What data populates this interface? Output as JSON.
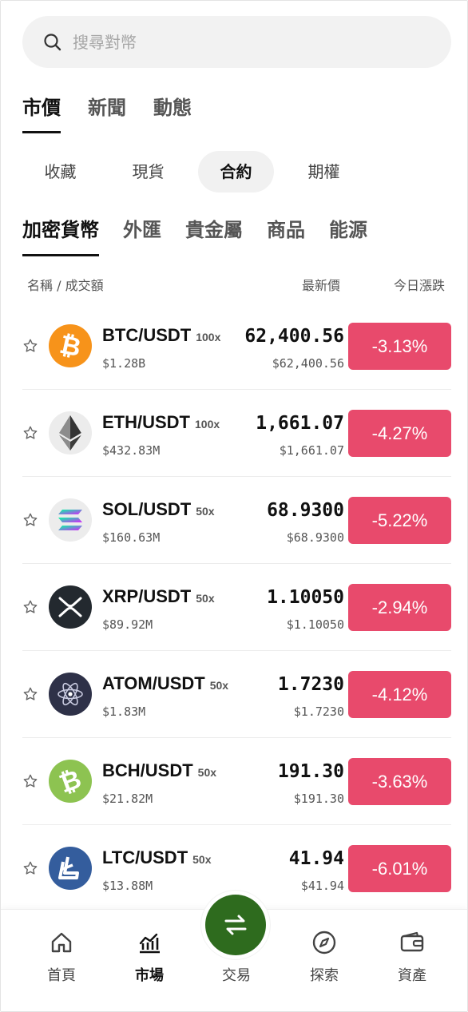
{
  "search": {
    "placeholder": "搜尋對幣"
  },
  "top_tabs": [
    {
      "label": "市價",
      "active": true
    },
    {
      "label": "新聞",
      "active": false
    },
    {
      "label": "動態",
      "active": false
    }
  ],
  "segments": [
    {
      "label": "收藏",
      "active": false
    },
    {
      "label": "現貨",
      "active": false
    },
    {
      "label": "合約",
      "active": true
    },
    {
      "label": "期權",
      "active": false
    }
  ],
  "categories": [
    {
      "label": "加密貨幣",
      "active": true
    },
    {
      "label": "外匯",
      "active": false
    },
    {
      "label": "貴金屬",
      "active": false
    },
    {
      "label": "商品",
      "active": false
    },
    {
      "label": "能源",
      "active": false
    }
  ],
  "columns": {
    "name": "名稱 / 成交額",
    "price": "最新價",
    "change": "今日漲跌"
  },
  "rows": [
    {
      "pair": "BTC/USDT",
      "leverage": "100x",
      "volume": "$1.28B",
      "price": "62,400.56",
      "price_usd": "$62,400.56",
      "change": "-3.13%",
      "icon": "bitcoin-icon",
      "icon_color": "#f7931a"
    },
    {
      "pair": "ETH/USDT",
      "leverage": "100x",
      "volume": "$432.83M",
      "price": "1,661.07",
      "price_usd": "$1,661.07",
      "change": "-4.27%",
      "icon": "ethereum-icon",
      "icon_color": "#ececec"
    },
    {
      "pair": "SOL/USDT",
      "leverage": "50x",
      "volume": "$160.63M",
      "price": "68.9300",
      "price_usd": "$68.9300",
      "change": "-5.22%",
      "icon": "solana-icon",
      "icon_color": "#ececec"
    },
    {
      "pair": "XRP/USDT",
      "leverage": "50x",
      "volume": "$89.92M",
      "price": "1.10050",
      "price_usd": "$1.10050",
      "change": "-2.94%",
      "icon": "xrp-icon",
      "icon_color": "#23292f"
    },
    {
      "pair": "ATOM/USDT",
      "leverage": "50x",
      "volume": "$1.83M",
      "price": "1.7230",
      "price_usd": "$1.7230",
      "change": "-4.12%",
      "icon": "cosmos-atom-icon",
      "icon_color": "#2e3148"
    },
    {
      "pair": "BCH/USDT",
      "leverage": "50x",
      "volume": "$21.82M",
      "price": "191.30",
      "price_usd": "$191.30",
      "change": "-3.63%",
      "icon": "bitcoin-cash-icon",
      "icon_color": "#8dc351"
    },
    {
      "pair": "LTC/USDT",
      "leverage": "50x",
      "volume": "$13.88M",
      "price": "41.94",
      "price_usd": "$41.94",
      "change": "-6.01%",
      "icon": "litecoin-icon",
      "icon_color": "#345d9d"
    }
  ],
  "colors": {
    "negative": "#e84a6c",
    "trade_button": "#2e6b1e"
  },
  "bottom_nav": [
    {
      "label": "首頁",
      "icon": "home-icon",
      "active": false
    },
    {
      "label": "市場",
      "icon": "market-chart-icon",
      "active": true
    },
    {
      "label": "交易",
      "icon": "swap-icon",
      "active": false
    },
    {
      "label": "探索",
      "icon": "compass-icon",
      "active": false
    },
    {
      "label": "資產",
      "icon": "wallet-icon",
      "active": false
    }
  ]
}
